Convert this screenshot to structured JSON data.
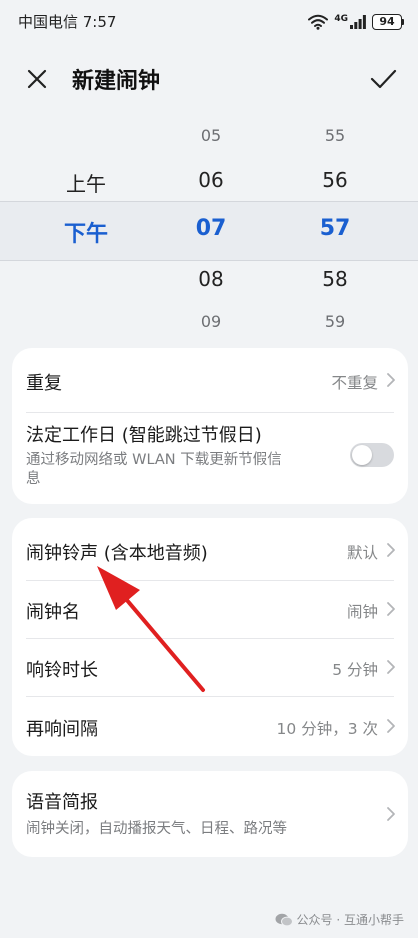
{
  "status_bar": {
    "carrier_time": "中国电信 7:57",
    "network": "4G",
    "battery": "94"
  },
  "header": {
    "title": "新建闹钟"
  },
  "picker": {
    "ampm": [
      "上午",
      "下午"
    ],
    "hours": [
      "05",
      "06",
      "07",
      "08",
      "09"
    ],
    "minutes": [
      "55",
      "56",
      "57",
      "58",
      "59"
    ],
    "selected": {
      "ampm": "下午",
      "hour": "07",
      "minute": "57"
    }
  },
  "repeat_card": {
    "repeat": {
      "label": "重复",
      "value": "不重复"
    },
    "workday": {
      "label": "法定工作日 (智能跳过节假日)",
      "desc_line1": "通过移动网络或 WLAN 下载更新节假信",
      "desc_line2": "息",
      "enabled": false
    }
  },
  "settings_card": {
    "rows": [
      {
        "label": "闹钟铃声 (含本地音频)",
        "value": "默认"
      },
      {
        "label": "闹钟名",
        "value": "闹钟"
      },
      {
        "label": "响铃时长",
        "value": "5 分钟"
      },
      {
        "label": "再响间隔",
        "value": "10 分钟，3 次"
      }
    ]
  },
  "voice_card": {
    "label": "语音简报",
    "desc": "闹钟关闭，自动播报天气、日程、路况等"
  },
  "annotation": {
    "color": "#e02020"
  },
  "watermark": {
    "text": "公众号 · 互通小帮手"
  },
  "colors": {
    "accent": "#1a5fd0",
    "background": "#f1f3f5"
  }
}
